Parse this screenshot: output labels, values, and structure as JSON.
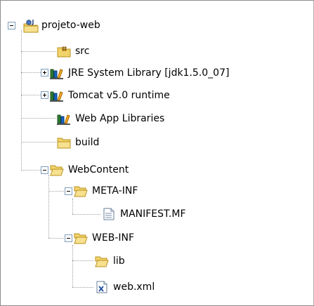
{
  "tree": {
    "project": {
      "label": "projeto-web",
      "icon": "java-project-icon",
      "expanded": true
    },
    "items": [
      {
        "id": "src",
        "label": "src",
        "icon": "source-folder-icon"
      },
      {
        "id": "jre",
        "label": "JRE System Library [jdk1.5.0_07]",
        "icon": "library-icon",
        "expanded": false
      },
      {
        "id": "tomcat",
        "label": "Tomcat v5.0 runtime",
        "icon": "library-icon",
        "expanded": false
      },
      {
        "id": "webapp-libs",
        "label": "Web App Libraries",
        "icon": "library-icon"
      },
      {
        "id": "build",
        "label": "build",
        "icon": "folder-icon"
      },
      {
        "id": "webcontent",
        "label": "WebContent",
        "icon": "folder-open-icon",
        "expanded": true
      },
      {
        "id": "meta-inf",
        "label": "META-INF",
        "icon": "folder-open-icon",
        "expanded": true
      },
      {
        "id": "manifest",
        "label": "MANIFEST.MF",
        "icon": "file-icon"
      },
      {
        "id": "web-inf",
        "label": "WEB-INF",
        "icon": "folder-open-icon",
        "expanded": true
      },
      {
        "id": "lib",
        "label": "lib",
        "icon": "folder-icon"
      },
      {
        "id": "webxml",
        "label": "web.xml",
        "icon": "xml-file-icon"
      }
    ]
  },
  "colors": {
    "folder": "#f2d36b",
    "folder_edge": "#b8901e",
    "library_books": [
      "#2e7d32",
      "#1565c0",
      "#f9a825"
    ],
    "guide_line": "#a0a0a0",
    "toggle_border": "#7f9db9"
  }
}
